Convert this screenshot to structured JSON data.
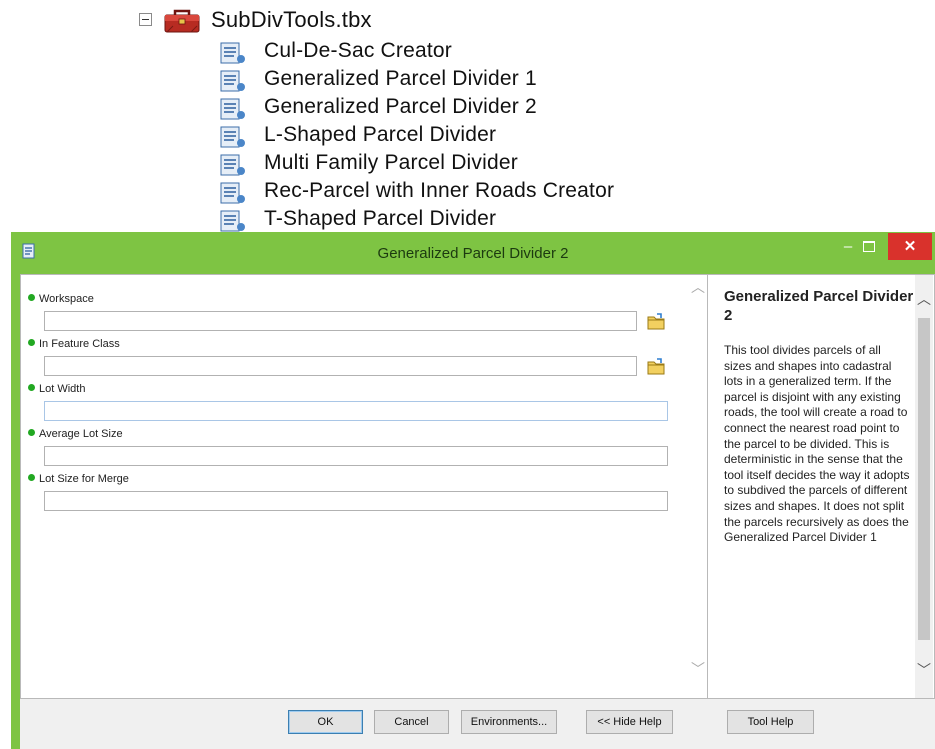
{
  "catalog": {
    "toolbox_name": "SubDivTools.tbx",
    "tools": [
      {
        "label": "Cul-De-Sac Creator"
      },
      {
        "label": "Generalized Parcel Divider 1"
      },
      {
        "label": "Generalized Parcel Divider 2"
      },
      {
        "label": "L-Shaped Parcel Divider"
      },
      {
        "label": "Multi Family Parcel Divider"
      },
      {
        "label": "Rec-Parcel with Inner Roads Creator"
      },
      {
        "label": "T-Shaped Parcel Divider"
      }
    ],
    "icons": {
      "toolbox": "toolbox-icon",
      "script": "script-tool-icon",
      "expander": "collapse-minus-icon"
    }
  },
  "dialog": {
    "title": "Generalized Parcel Divider 2",
    "window_buttons": {
      "minimize": "–",
      "close": "✕"
    },
    "params": [
      {
        "label": "Workspace",
        "value": "",
        "browse": true
      },
      {
        "label": "In Feature Class",
        "value": "",
        "browse": true
      },
      {
        "label": "Lot Width",
        "value": "",
        "browse": false
      },
      {
        "label": "Average Lot Size",
        "value": "",
        "browse": false
      },
      {
        "label": "Lot Size for Merge",
        "value": "",
        "browse": false
      }
    ],
    "help": {
      "title": "Generalized Parcel Divider 2",
      "body": "This tool divides parcels of all sizes and shapes into cadastral lots in a generalized term. If the parcel is disjoint with any existing roads, the tool will create a road to connect the nearest road point to the parcel to be divided. This is deterministic in the sense that the tool itself decides the way it adopts to subdived the parcels of different sizes and shapes. It does not split the parcels recursively as does the Generalized Parcel Divider 1"
    },
    "buttons": {
      "ok": "OK",
      "cancel": "Cancel",
      "environments": "Environments...",
      "hide_help": "<< Hide Help",
      "tool_help": "Tool Help"
    },
    "colors": {
      "title_bar": "#7ec443",
      "close_button": "#d9322c",
      "required_dot": "#22a822"
    }
  }
}
